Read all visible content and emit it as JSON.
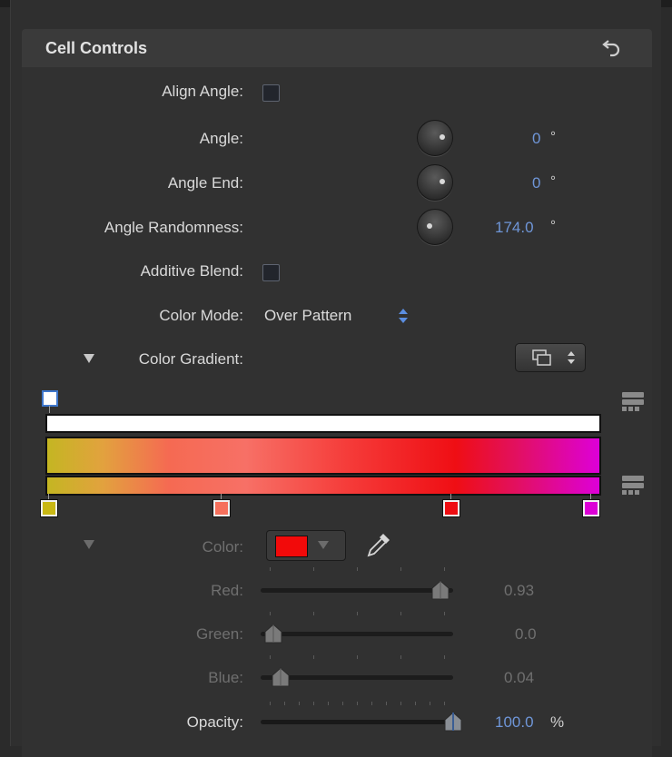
{
  "panel": {
    "title": "Cell Controls"
  },
  "rows": {
    "align_angle": {
      "label": "Align Angle:"
    },
    "angle": {
      "label": "Angle:",
      "value": "0",
      "unit": "°"
    },
    "angle_end": {
      "label": "Angle End:",
      "value": "0",
      "unit": "°"
    },
    "angle_randomness": {
      "label": "Angle Randomness:",
      "value": "174.0",
      "unit": "°"
    },
    "additive_blend": {
      "label": "Additive Blend:"
    },
    "color_mode": {
      "label": "Color Mode:",
      "value": "Over Pattern"
    },
    "color_gradient": {
      "label": "Color Gradient:"
    }
  },
  "gradient": {
    "stops": [
      "#c9b814",
      "#f6705c",
      "#ee0d12",
      "#dc00d6"
    ],
    "opacity_stop": "#ffffff"
  },
  "color": {
    "label": "Color:",
    "swatch": "#f20a0a",
    "red": {
      "label": "Red:",
      "value": "0.93",
      "level": 0.93
    },
    "green": {
      "label": "Green:",
      "value": "0.0",
      "level": 0.0
    },
    "blue": {
      "label": "Blue:",
      "value": "0.04",
      "level": 0.04
    },
    "opacity": {
      "label": "Opacity:",
      "value": "100.0",
      "unit": "%",
      "level": 1.0
    }
  },
  "icons": {
    "reset": "reset-arrow-icon",
    "eyedropper": "eyedropper-icon",
    "stepper": "up-down-stepper-icon",
    "disclosure": "disclosure-triangle-icon"
  }
}
